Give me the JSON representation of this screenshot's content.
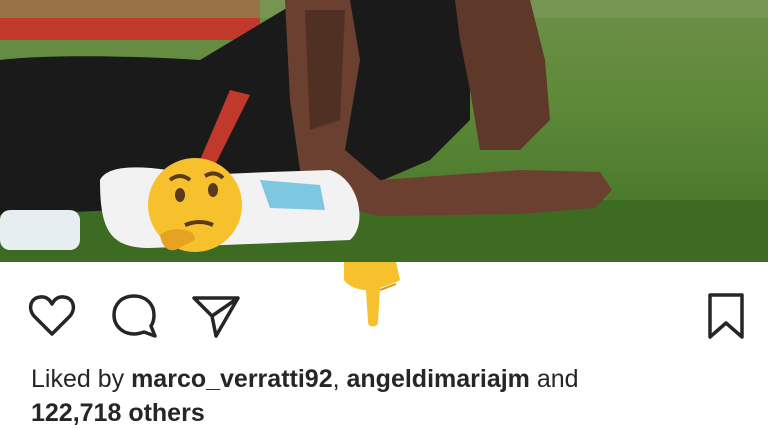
{
  "post": {
    "image_alt_icon": "thinking-face-emoji"
  },
  "actions": {
    "like_icon": "heart-outline-icon",
    "comment_icon": "comment-bubble-icon",
    "share_icon": "paper-plane-icon",
    "save_icon": "bookmark-outline-icon",
    "pointer_emoji": "pointing-down-hand-emoji"
  },
  "caption": {
    "liked_by": "Liked by",
    "user1": "marco_verratti92",
    "separator": ",",
    "user2": "angeldimariajm",
    "and": "and",
    "others": "122,718 others"
  }
}
